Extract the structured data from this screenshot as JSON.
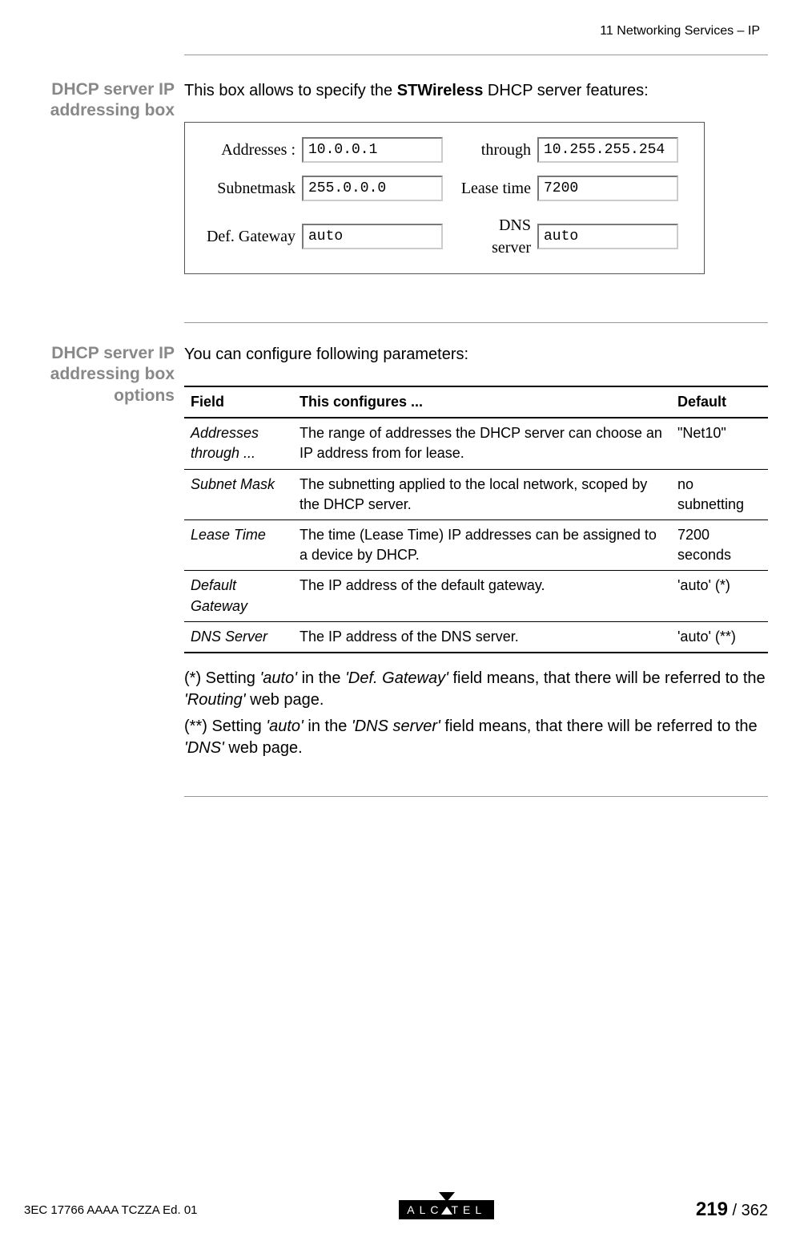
{
  "header": {
    "breadcrumb": "11 Networking Services – IP"
  },
  "section1": {
    "sideLabel1": "DHCP server IP",
    "sideLabel2": "addressing box",
    "introPrefix": "This box allows to specify the ",
    "introBold": "STWireless",
    "introSuffix": " DHCP server features:",
    "form": {
      "addresses_label": "Addresses :",
      "addresses_value": "10.0.0.1",
      "through_label": "through",
      "through_value": "10.255.255.254",
      "subnet_label": "Subnetmask",
      "subnet_value": "255.0.0.0",
      "lease_label": "Lease time",
      "lease_value": "7200",
      "gateway_label": "Def. Gateway",
      "gateway_value": "auto",
      "dns_label": "DNS server",
      "dns_value": "auto"
    }
  },
  "section2": {
    "sideLabel1": "DHCP server IP",
    "sideLabel2": "addressing box options",
    "intro": "You can configure following parameters:",
    "table": {
      "headers": {
        "c1": "Field",
        "c2": "This configures ...",
        "c3": "Default"
      },
      "rows": [
        {
          "field": "Addresses through ...",
          "desc": "The range of addresses the DHCP server can choose an IP address from for lease.",
          "def": "\"Net10\""
        },
        {
          "field": "Subnet Mask",
          "desc": "The subnetting applied to the local network, scoped by the DHCP server.",
          "def": "no subnetting"
        },
        {
          "field": "Lease Time",
          "desc": "The time (Lease Time) IP addresses can be assigned to a device by DHCP.",
          "def": "7200 seconds"
        },
        {
          "field": "Default Gateway",
          "desc": "The IP address of the default gateway.",
          "def": "'auto' (*)"
        },
        {
          "field": "DNS Server",
          "desc": "The IP address of the DNS server.",
          "def": "'auto' (**)"
        }
      ]
    },
    "note1": {
      "p1": "(*) Setting ",
      "i1": "'auto'",
      "p2": " in the ",
      "i2": "'Def. Gateway'",
      "p3": " field means, that there will be referred to the ",
      "i3": "'Routing'",
      "p4": " web page."
    },
    "note2": {
      "p1": "(**) Setting ",
      "i1": "'auto'",
      "p2": " in the ",
      "i2": "'DNS server'",
      "p3": " field means, that there will be referred to the ",
      "i3": "'DNS'",
      "p4": " web page."
    }
  },
  "footer": {
    "left": "3EC 17766 AAAA TCZZA Ed. 01",
    "logo_pre": "ALC",
    "logo_post": "TEL",
    "page_current": "219",
    "page_sep": " / 362"
  }
}
